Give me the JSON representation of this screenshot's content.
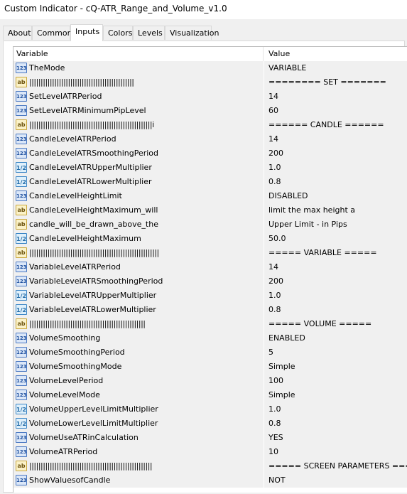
{
  "window": {
    "title": "Custom Indicator - cQ-ATR_Range_and_Volume_v1.0"
  },
  "tabs": [
    {
      "label": "About"
    },
    {
      "label": "Common"
    },
    {
      "label": "Inputs"
    },
    {
      "label": "Colors"
    },
    {
      "label": "Levels"
    },
    {
      "label": "Visualization"
    }
  ],
  "active_tab": "Inputs",
  "table": {
    "headers": {
      "variable": "Variable",
      "value": "Value"
    },
    "rows": [
      {
        "type": "int",
        "icon": "123",
        "name": "TheMode",
        "value": "VARIABLE"
      },
      {
        "type": "str",
        "icon": "ab",
        "name": "||||||||||||||||||||||||||||||||||||||||||||||",
        "value": "======== SET ======="
      },
      {
        "type": "int",
        "icon": "123",
        "name": "SetLevelATRPeriod",
        "value": "14"
      },
      {
        "type": "int",
        "icon": "123",
        "name": "SetLevelATRMinimumPipLevel",
        "value": "60"
      },
      {
        "type": "str",
        "icon": "ab",
        "name": "||||||||||||||||||||||||||||||||||||||||||||||||||||||i",
        "value": "====== CANDLE ======"
      },
      {
        "type": "int",
        "icon": "123",
        "name": "CandleLevelATRPeriod",
        "value": "14"
      },
      {
        "type": "int",
        "icon": "123",
        "name": "CandleLevelATRSmoothingPeriod",
        "value": "200"
      },
      {
        "type": "dbl",
        "icon": "1/2",
        "name": "CandleLevelATRUpperMultiplier",
        "value": "1.0"
      },
      {
        "type": "dbl",
        "icon": "1/2",
        "name": "CandleLevelATRLowerMultiplier",
        "value": "0.8"
      },
      {
        "type": "int",
        "icon": "123",
        "name": "CandleLevelHeightLimit",
        "value": "DISABLED"
      },
      {
        "type": "str",
        "icon": "ab",
        "name": "CandleLevelHeightMaximum_will",
        "value": "limit the max height a"
      },
      {
        "type": "str",
        "icon": "ab",
        "name": "candle_will_be_drawn_above_the",
        "value": "Upper Limit - in Pips"
      },
      {
        "type": "dbl",
        "icon": "1/2",
        "name": "CandleLevelHeightMaximum",
        "value": "50.0"
      },
      {
        "type": "str",
        "icon": "ab",
        "name": "|||||||||||||||||||||||||||||||||||||||||||||||||||||||||",
        "value": "===== VARIABLE ====="
      },
      {
        "type": "int",
        "icon": "123",
        "name": "VariableLevelATRPeriod",
        "value": "14"
      },
      {
        "type": "int",
        "icon": "123",
        "name": "VariableLevelATRSmoothingPeriod",
        "value": "200"
      },
      {
        "type": "dbl",
        "icon": "1/2",
        "name": "VariableLevelATRUpperMultiplier",
        "value": "1.0"
      },
      {
        "type": "dbl",
        "icon": "1/2",
        "name": "VariableLevelATRLowerMultiplier",
        "value": "0.8"
      },
      {
        "type": "str",
        "icon": "ab",
        "name": "|||||||||||||||||||||||||||||||||||||||||||||||||||",
        "value": "===== VOLUME ====="
      },
      {
        "type": "int",
        "icon": "123",
        "name": "VolumeSmoothing",
        "value": "ENABLED"
      },
      {
        "type": "int",
        "icon": "123",
        "name": "VolumeSmoothingPeriod",
        "value": "5"
      },
      {
        "type": "int",
        "icon": "123",
        "name": "VolumeSmoothingMode",
        "value": "Simple"
      },
      {
        "type": "int",
        "icon": "123",
        "name": "VolumeLevelPeriod",
        "value": "100"
      },
      {
        "type": "int",
        "icon": "123",
        "name": "VolumeLevelMode",
        "value": "Simple"
      },
      {
        "type": "dbl",
        "icon": "1/2",
        "name": "VolumeUpperLevelLimitMultiplier",
        "value": "1.0"
      },
      {
        "type": "dbl",
        "icon": "1/2",
        "name": "VolumeLowerLevelLimitMultiplier",
        "value": "0.8"
      },
      {
        "type": "int",
        "icon": "123",
        "name": "VolumeUseATRinCalculation",
        "value": "YES"
      },
      {
        "type": "int",
        "icon": "123",
        "name": "VolumeATRPeriod",
        "value": "10"
      },
      {
        "type": "str",
        "icon": "ab",
        "name": "||||||||||||||||||||||||||||||||||||||||||||||||||||||",
        "value": "===== SCREEN PARAMETERS ====="
      },
      {
        "type": "int",
        "icon": "123",
        "name": "ShowValuesofCandle",
        "value": "NOT"
      }
    ]
  }
}
